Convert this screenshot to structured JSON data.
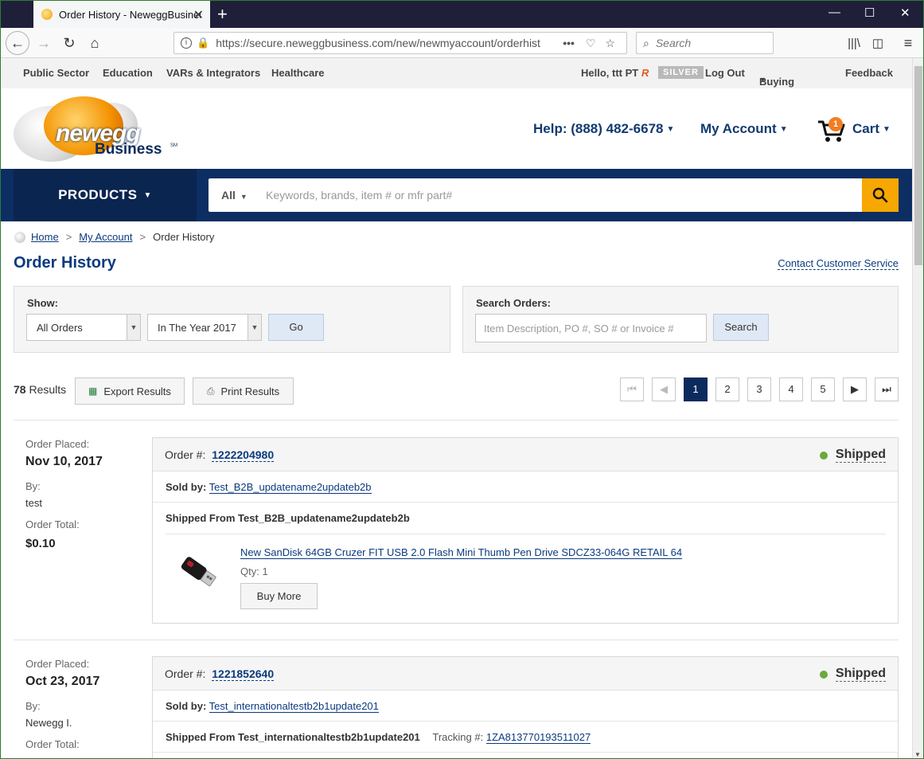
{
  "browser": {
    "tab_title": "Order History - NeweggBusiness",
    "url": "https://secure.neweggbusiness.com/new/newmyaccount/orderhist",
    "search_placeholder": "Search"
  },
  "utility": {
    "links": [
      "Public Sector",
      "Education",
      "VARs & Integrators",
      "Healthcare"
    ],
    "greeting": "Hello, ttt PT",
    "tier": "SILVER",
    "logout": "Log Out",
    "buying_tools": "Buying Tools",
    "feedback": "Feedback"
  },
  "header": {
    "logo_word": "newegg",
    "logo_business": "Business",
    "logo_sm": "SM",
    "help": "Help: (888) 482-6678",
    "my_account": "My Account",
    "cart_label": "Cart",
    "cart_count": "1"
  },
  "search": {
    "products": "PRODUCTS",
    "scope": "All",
    "placeholder": "Keywords, brands, item # or mfr part#"
  },
  "breadcrumb": {
    "home": "Home",
    "account": "My Account",
    "current": "Order History"
  },
  "page": {
    "title": "Order History",
    "contact": "Contact Customer Service"
  },
  "filters": {
    "show_label": "Show:",
    "type_value": "All Orders",
    "period_value": "In The Year 2017",
    "go": "Go",
    "search_label": "Search Orders:",
    "search_placeholder": "Item Description, PO #, SO # or Invoice #",
    "search_button": "Search"
  },
  "results": {
    "count": "78",
    "label": "Results",
    "export": "Export Results",
    "print": "Print Results",
    "pages": [
      "1",
      "2",
      "3",
      "4",
      "5"
    ],
    "current_page": "1"
  },
  "labels": {
    "order_placed": "Order Placed:",
    "by": "By:",
    "order_total": "Order Total:",
    "order_num": "Order #:",
    "sold_by": "Sold by:",
    "tracking": "Tracking #:",
    "qty_prefix": "Qty:",
    "buy_more": "Buy More"
  },
  "orders": [
    {
      "date": "Nov 10, 2017",
      "by": "test",
      "total": "$0.10",
      "number": "1222204980",
      "status": "Shipped",
      "status_color": "#6aaa3a",
      "seller": "Test_B2B_updatename2updateb2b",
      "shipped_from": "Shipped From Test_B2B_updatename2updateb2b",
      "item_name": "New SanDisk 64GB Cruzer FIT USB 2.0 Flash Mini Thumb Pen Drive SDCZ33-064G RETAIL 64",
      "qty": "1"
    },
    {
      "date": "Oct 23, 2017",
      "by": "Newegg I.",
      "number": "1221852640",
      "status": "Shipped",
      "status_color": "#6aaa3a",
      "seller": "Test_internationaltestb2b1update201",
      "shipped_from": "Shipped From Test_internationaltestb2b1update201",
      "tracking": "1ZA813770193511027"
    }
  ],
  "colors": {
    "brand_navy": "#0c2e63",
    "accent_orange": "#f7a800",
    "link_blue": "#0b3a7e"
  }
}
